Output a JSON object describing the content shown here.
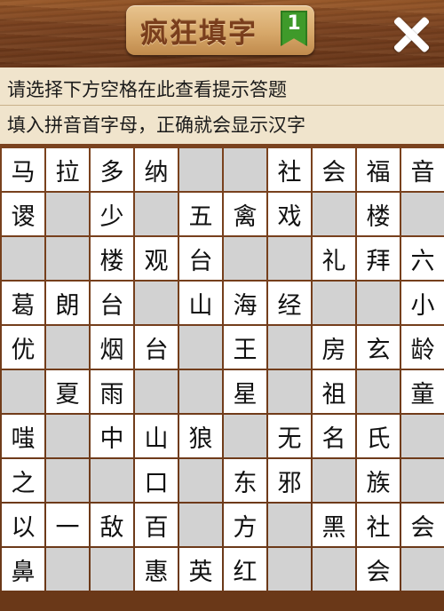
{
  "header": {
    "title": "疯狂填字",
    "level": "1",
    "close_icon": "close-x-icon",
    "colors": {
      "wood": "#7a4220",
      "plaque": "#d7a86a",
      "badge": "#3f9a2a"
    }
  },
  "hint": {
    "line1": "请选择下方空格在此查看提示答题",
    "line2": "填入拼音首字母，正确就会显示汉字"
  },
  "grid": {
    "rows": [
      [
        "马",
        "拉",
        "多",
        "纳",
        "",
        "",
        "社",
        "会",
        "福",
        "音"
      ],
      [
        "谡",
        "",
        "少",
        "",
        "五",
        "禽",
        "戏",
        "",
        "楼",
        ""
      ],
      [
        "",
        "",
        "楼",
        "观",
        "台",
        "",
        "",
        "礼",
        "拜",
        "六"
      ],
      [
        "葛",
        "朗",
        "台",
        "",
        "山",
        "海",
        "经",
        "",
        "",
        "小"
      ],
      [
        "优",
        "",
        "烟",
        "台",
        "",
        "王",
        "",
        "房",
        "玄",
        "龄"
      ],
      [
        "",
        "夏",
        "雨",
        "",
        "",
        "星",
        "",
        "祖",
        "",
        "童"
      ],
      [
        "嗤",
        "",
        "中",
        "山",
        "狼",
        "",
        "无",
        "名",
        "氏",
        ""
      ],
      [
        "之",
        "",
        "",
        "口",
        "",
        "东",
        "邪",
        "",
        "族",
        ""
      ],
      [
        "以",
        "一",
        "敌",
        "百",
        "",
        "方",
        "",
        "黑",
        "社",
        "会"
      ],
      [
        "鼻",
        "",
        "",
        "惠",
        "英",
        "红",
        "",
        "",
        "会",
        ""
      ]
    ],
    "filled": [
      [
        1,
        1,
        1,
        1,
        0,
        0,
        1,
        1,
        1,
        1
      ],
      [
        1,
        0,
        1,
        0,
        1,
        1,
        1,
        0,
        1,
        0
      ],
      [
        0,
        0,
        1,
        1,
        1,
        0,
        0,
        1,
        1,
        1
      ],
      [
        1,
        1,
        1,
        0,
        1,
        1,
        1,
        0,
        0,
        1
      ],
      [
        1,
        0,
        1,
        1,
        0,
        1,
        0,
        1,
        1,
        1
      ],
      [
        0,
        1,
        1,
        0,
        0,
        1,
        0,
        1,
        0,
        1
      ],
      [
        1,
        0,
        1,
        1,
        1,
        0,
        1,
        1,
        1,
        0
      ],
      [
        1,
        0,
        0,
        1,
        0,
        1,
        1,
        0,
        1,
        0
      ],
      [
        1,
        1,
        1,
        1,
        0,
        1,
        0,
        1,
        1,
        1
      ],
      [
        1,
        0,
        0,
        1,
        1,
        1,
        0,
        0,
        1,
        0
      ]
    ]
  }
}
